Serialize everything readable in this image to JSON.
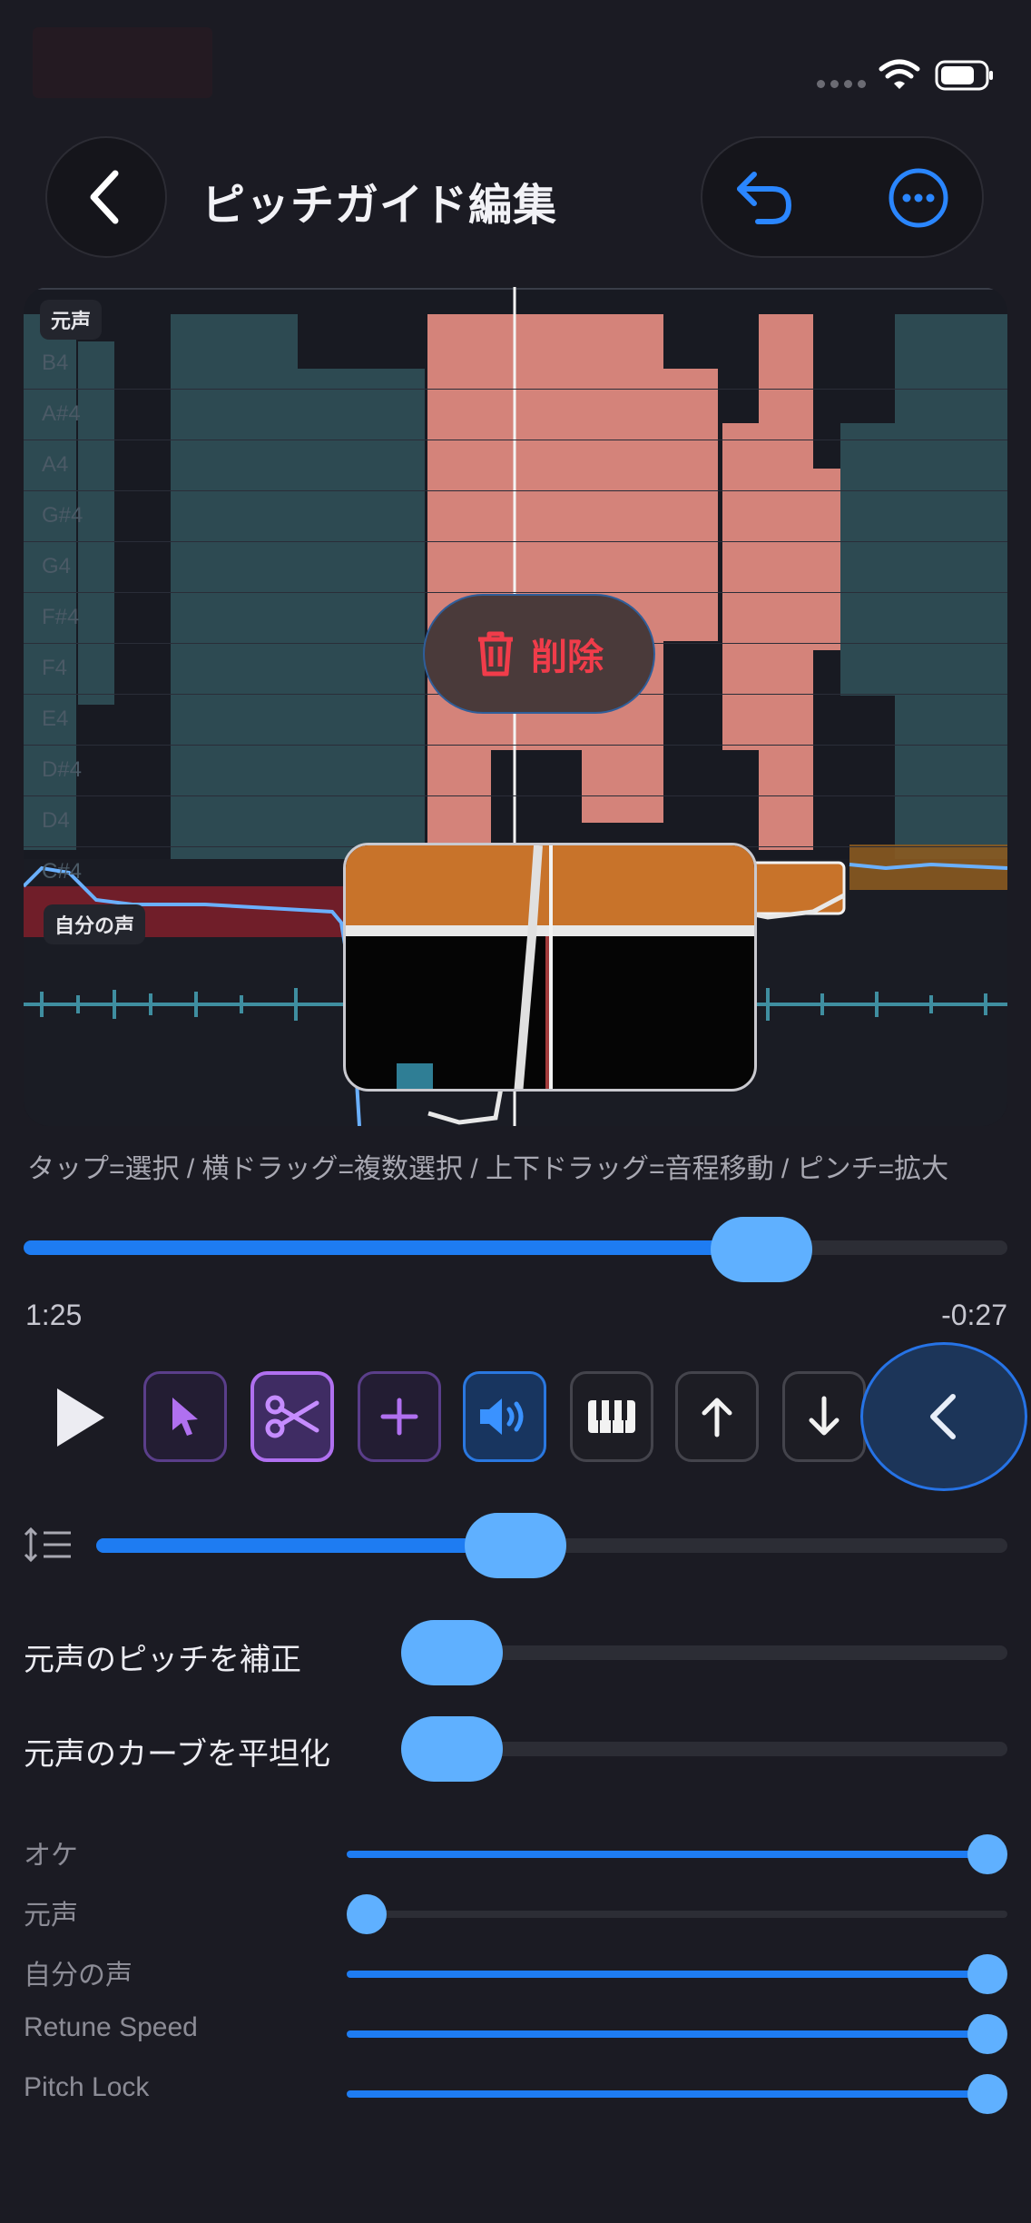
{
  "header": {
    "title": "ピッチガイド編集"
  },
  "editor": {
    "track_label_original": "元声",
    "track_label_mine": "自分の声",
    "note_labels": [
      "B4",
      "A#4",
      "A4",
      "G#4",
      "G4",
      "F#4",
      "F4",
      "E4",
      "D#4",
      "D4",
      "C#4"
    ],
    "delete_label": "削除"
  },
  "hint": "タップ=選択 / 横ドラッグ=複数選択 / 上下ドラッグ=音程移動 / ピンチ=拡大",
  "playback": {
    "progress": 0.75,
    "elapsed": "1:25",
    "remaining": "-0:27"
  },
  "zoom": {
    "level": 0.46
  },
  "toggles": {
    "correct_pitch_label": "元声のピッチを補正",
    "flatten_curve_label": "元声のカーブを平坦化"
  },
  "mix": {
    "items": [
      {
        "label": "オケ",
        "value": 1.0
      },
      {
        "label": "元声",
        "value": 0.0
      },
      {
        "label": "自分の声",
        "value": 1.0
      },
      {
        "label": "Retune Speed",
        "value": 1.0
      },
      {
        "label": "Pitch Lock",
        "value": 1.0
      }
    ]
  },
  "colors": {
    "accent": "#1e7cf2",
    "thumb": "#5fb0ff",
    "delete": "#f03c4a",
    "note_block": "#c8732a",
    "original_wave": "#2d4a52",
    "selected_wave": "#d4837a"
  },
  "icons": {
    "back": "chevron-left-icon",
    "undo": "undo-icon",
    "more": "more-icon",
    "delete": "trash-icon",
    "play": "play-icon",
    "select": "cursor-icon",
    "split": "scissors-icon",
    "add": "plus-icon",
    "volume": "speaker-icon",
    "piano": "piano-icon",
    "up": "arrow-up-icon",
    "down": "arrow-down-icon",
    "collapse": "chevron-left-icon",
    "spacing": "line-spacing-icon"
  }
}
